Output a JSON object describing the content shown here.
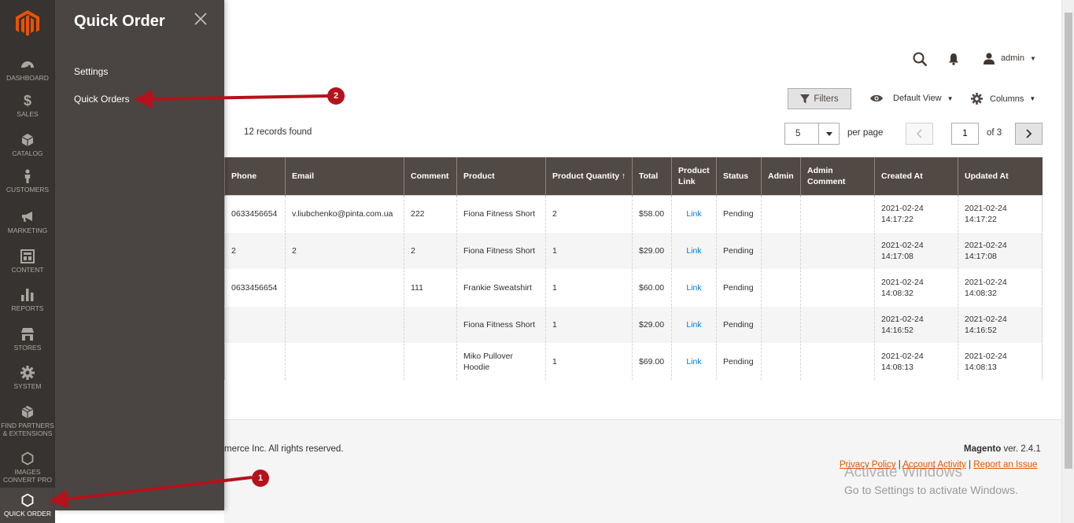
{
  "nav": {
    "items": [
      {
        "label": "DASHBOARD",
        "icon": "dashboard-icon"
      },
      {
        "label": "SALES",
        "icon": "dollar-icon"
      },
      {
        "label": "CATALOG",
        "icon": "cube-icon"
      },
      {
        "label": "CUSTOMERS",
        "icon": "person-icon"
      },
      {
        "label": "MARKETING",
        "icon": "megaphone-icon"
      },
      {
        "label": "CONTENT",
        "icon": "layout-icon"
      },
      {
        "label": "REPORTS",
        "icon": "bar-chart-icon"
      },
      {
        "label": "STORES",
        "icon": "store-icon"
      },
      {
        "label": "SYSTEM",
        "icon": "gear-icon"
      },
      {
        "label": "FIND PARTNERS & EXTENSIONS",
        "icon": "boxes-icon"
      },
      {
        "label": "IMAGES CONVERT PRO",
        "icon": "hexagon-icon"
      },
      {
        "label": "QUICK ORDER",
        "icon": "hexagon-icon"
      }
    ]
  },
  "flyout": {
    "title": "Quick Order",
    "links": [
      "Settings",
      "Quick Orders"
    ]
  },
  "header": {
    "admin_label": "admin"
  },
  "toolbar": {
    "filters_label": "Filters",
    "view_label": "Default View",
    "columns_label": "Columns",
    "records_found": "12 records found",
    "per_page_value": "5",
    "per_page_label": "per page",
    "page_value": "1",
    "page_of": "of 3"
  },
  "grid": {
    "columns": [
      "Phone",
      "Email",
      "Comment",
      "Product",
      "Product Quantity",
      "Total",
      "Product Link",
      "Status",
      "Admin",
      "Admin Comment",
      "Created At",
      "Updated At"
    ],
    "rows": [
      {
        "phone": "0633456654",
        "email": "v.liubchenko@pinta.com.ua",
        "comment": "222",
        "product": "Fiona Fitness Short",
        "qty": "2",
        "total": "$58.00",
        "link": "Link",
        "status": "Pending",
        "admin": "",
        "admin_comment": "",
        "created": "2021-02-24 14:17:22",
        "updated": "2021-02-24 14:17:22"
      },
      {
        "phone": "2",
        "email": "2",
        "comment": "2",
        "product": "Fiona Fitness Short",
        "qty": "1",
        "total": "$29.00",
        "link": "Link",
        "status": "Pending",
        "admin": "",
        "admin_comment": "",
        "created": "2021-02-24 14:17:08",
        "updated": "2021-02-24 14:17:08"
      },
      {
        "phone": "0633456654",
        "email": "",
        "comment": "111",
        "product": "Frankie Sweatshirt",
        "qty": "1",
        "total": "$60.00",
        "link": "Link",
        "status": "Pending",
        "admin": "",
        "admin_comment": "",
        "created": "2021-02-24 14:08:32",
        "updated": "2021-02-24 14:08:32"
      },
      {
        "phone": "",
        "email": "",
        "comment": "",
        "product": "Fiona Fitness Short",
        "qty": "1",
        "total": "$29.00",
        "link": "Link",
        "status": "Pending",
        "admin": "",
        "admin_comment": "",
        "created": "2021-02-24 14:16:52",
        "updated": "2021-02-24 14:16:52"
      },
      {
        "phone": "",
        "email": "",
        "comment": "",
        "product": "Miko Pullover Hoodie",
        "qty": "1",
        "total": "$69.00",
        "link": "Link",
        "status": "Pending",
        "admin": "",
        "admin_comment": "",
        "created": "2021-02-24 14:08:13",
        "updated": "2021-02-24 14:08:13"
      }
    ]
  },
  "footer": {
    "copyright": "merce Inc. All rights reserved.",
    "version_brand": "Magento",
    "version_text": " ver. 2.4.1",
    "links": [
      "Privacy Policy",
      "Account Activity",
      "Report an Issue"
    ],
    "separator": " | "
  },
  "watermark": {
    "line1": "Activate Windows",
    "line2": "Go to Settings to activate Windows."
  },
  "annotations": {
    "badge1": "1",
    "badge2": "2"
  },
  "colors": {
    "nav_bg": "#373330",
    "flyout_bg": "#4a4542",
    "grid_header": "#514943",
    "accent": "#eb5202",
    "annotation": "#b5121b",
    "link": "#007bdb"
  }
}
